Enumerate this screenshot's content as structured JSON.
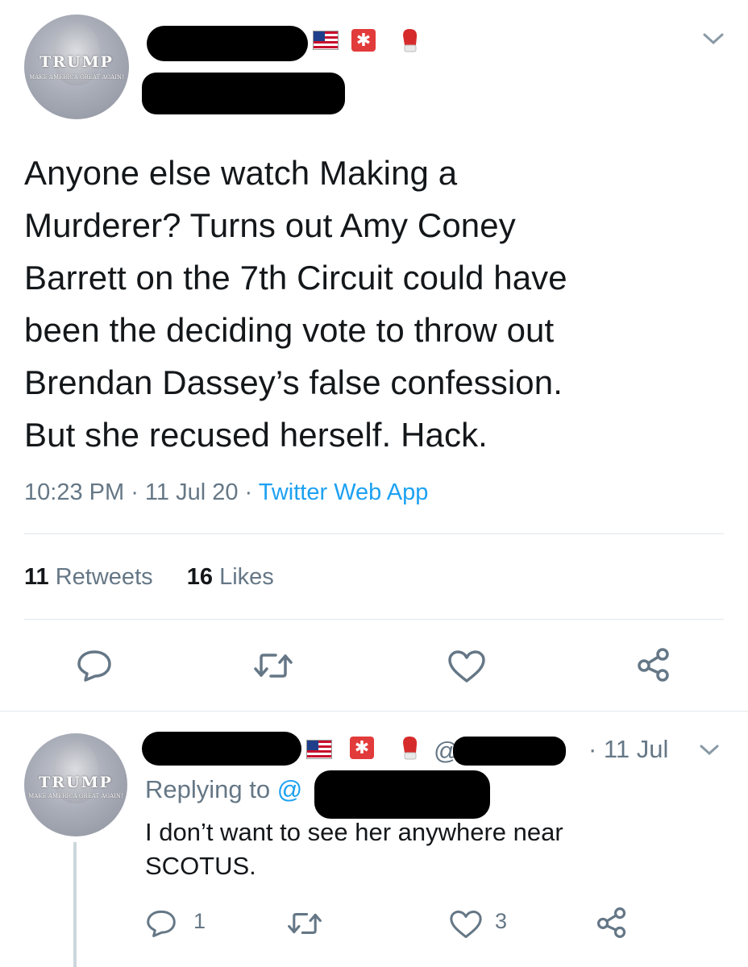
{
  "main_tweet": {
    "avatar": {
      "brand": "TRUMP",
      "tagline": "MAKE AMERICA GREAT AGAIN!"
    },
    "badges": [
      "us-flag-icon",
      "police-light-icon",
      "boxing-glove-icon"
    ],
    "lines": [
      "Anyone else watch Making a",
      "Murderer? Turns out Amy Coney",
      "Barrett on the 7th Circuit could have",
      "been the deciding vote to throw out",
      "Brendan Dassey’s false confession.",
      "But she recused herself. Hack."
    ],
    "time": "10:23 PM",
    "date": "11 Jul 20",
    "source": "Twitter Web App",
    "retweets_count": "11",
    "retweets_label": "Retweets",
    "likes_count": "16",
    "likes_label": "Likes"
  },
  "reply_tweet": {
    "avatar": {
      "brand": "TRUMP",
      "tagline": "MAKE AMERICA GREAT AGAIN!"
    },
    "handle_prefix": "@",
    "date": "· 11 Jul",
    "replying_to_label": "Replying to",
    "replying_to_at": "@",
    "text_lines": [
      "I don’t want to see her anywhere near",
      "SCOTUS."
    ],
    "reply_count": "1",
    "retweet_count": "",
    "like_count": "3"
  },
  "colors": {
    "link": "#1da1f2",
    "muted": "#657786",
    "icon": "#657786",
    "text": "#14171a"
  }
}
